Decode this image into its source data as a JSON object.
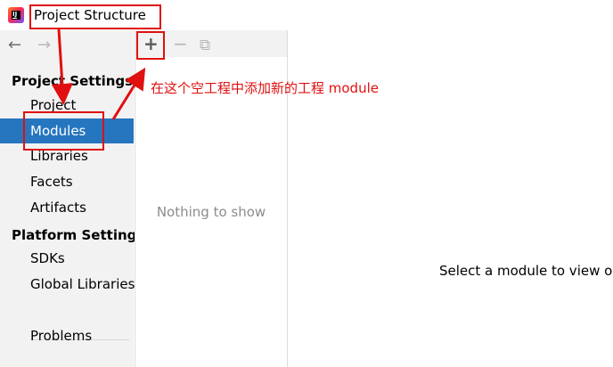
{
  "window": {
    "title": "Project Structure",
    "app_icon_letter": "IJ"
  },
  "nav": {
    "back_icon": "←",
    "forward_icon": "→"
  },
  "sidebar": {
    "project_settings_header": "Project Settings",
    "project_items": [
      "Project",
      "Modules",
      "Libraries",
      "Facets",
      "Artifacts"
    ],
    "platform_settings_header": "Platform Settings",
    "platform_items": [
      "SDKs",
      "Global Libraries"
    ],
    "problems": "Problems",
    "selected": "Modules",
    "selected_color": "#2675bf"
  },
  "toolbar": {
    "add_icon": "+",
    "remove_icon": "−",
    "copy_icon": "⧉"
  },
  "middle": {
    "empty_text": "Nothing to show"
  },
  "detail": {
    "placeholder": "Select a module to view or"
  },
  "annotation": {
    "text": "在这个空工程中添加新的工程 module",
    "color": "#e01010"
  }
}
